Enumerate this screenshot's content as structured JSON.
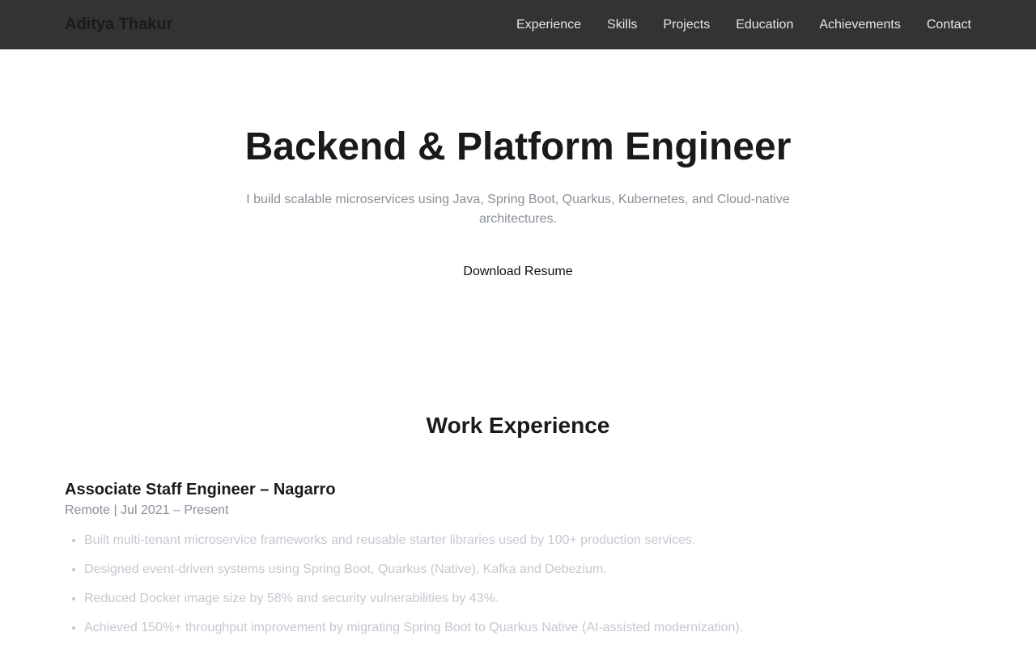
{
  "nav": {
    "brand": "Aditya Thakur",
    "links": [
      "Experience",
      "Skills",
      "Projects",
      "Education",
      "Achievements",
      "Contact"
    ]
  },
  "hero": {
    "title": "Backend & Platform Engineer",
    "subtitle": "I build scalable microservices using Java, Spring Boot, Quarkus, Kubernetes, and Cloud-native architectures.",
    "resume_label": "Download Resume"
  },
  "experience": {
    "heading": "Work Experience",
    "jobs": [
      {
        "title": "Associate Staff Engineer – Nagarro",
        "meta": "Remote | Jul 2021 – Present",
        "points": [
          "Built multi-tenant microservice frameworks and reusable starter libraries used by 100+ production services.",
          "Designed event-driven systems using Spring Boot, Quarkus (Native), Kafka and Debezium.",
          "Reduced Docker image size by 58% and security vulnerabilities by 43%.",
          "Achieved 150%+ throughput improvement by migrating Spring Boot to Quarkus Native (AI-assisted modernization)."
        ]
      }
    ]
  },
  "colors": {
    "navbar_bg": "#333333",
    "nav_link": "#e6e6e6",
    "muted_text": "#8a8f99",
    "faded_text": "#c4c8cf"
  }
}
